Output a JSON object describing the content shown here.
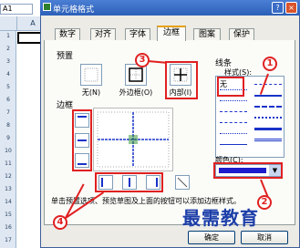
{
  "excel": {
    "name_box": "A1",
    "col_a": "A",
    "col_b": "B",
    "rows": [
      "1",
      "2",
      "3",
      "4",
      "5",
      "6",
      "7",
      "8",
      "9",
      "10",
      "11",
      "12",
      "13",
      "14",
      "15",
      "16",
      "17"
    ]
  },
  "dialog": {
    "title": "单元格格式",
    "help_btn": "?",
    "close_btn": "×",
    "tabs": [
      {
        "label": "数字"
      },
      {
        "label": "对齐"
      },
      {
        "label": "字体"
      },
      {
        "label": "边框"
      },
      {
        "label": "图案"
      },
      {
        "label": "保护"
      }
    ],
    "active_tab": "边框",
    "preset_group": "预置",
    "presets": [
      {
        "label": "无(N)"
      },
      {
        "label": "外边框(O)"
      },
      {
        "label": "内部(I)"
      }
    ],
    "border_group": "边框",
    "line_group": "线条",
    "style_label": "样式(S):",
    "style_none": "无",
    "color_label": "颜色(C):",
    "color_value": "#1c1ccc",
    "hint": "单击预置选项、预览草图及上面的按钮可以添加边框样式。",
    "ok": "确定",
    "cancel": "取消",
    "callouts": [
      "1",
      "2",
      "3",
      "4"
    ]
  },
  "watermark": "最需教育",
  "colors": {
    "accent": "#e02020",
    "title": "#2c5fb8",
    "border_line": "#1a33c8"
  }
}
